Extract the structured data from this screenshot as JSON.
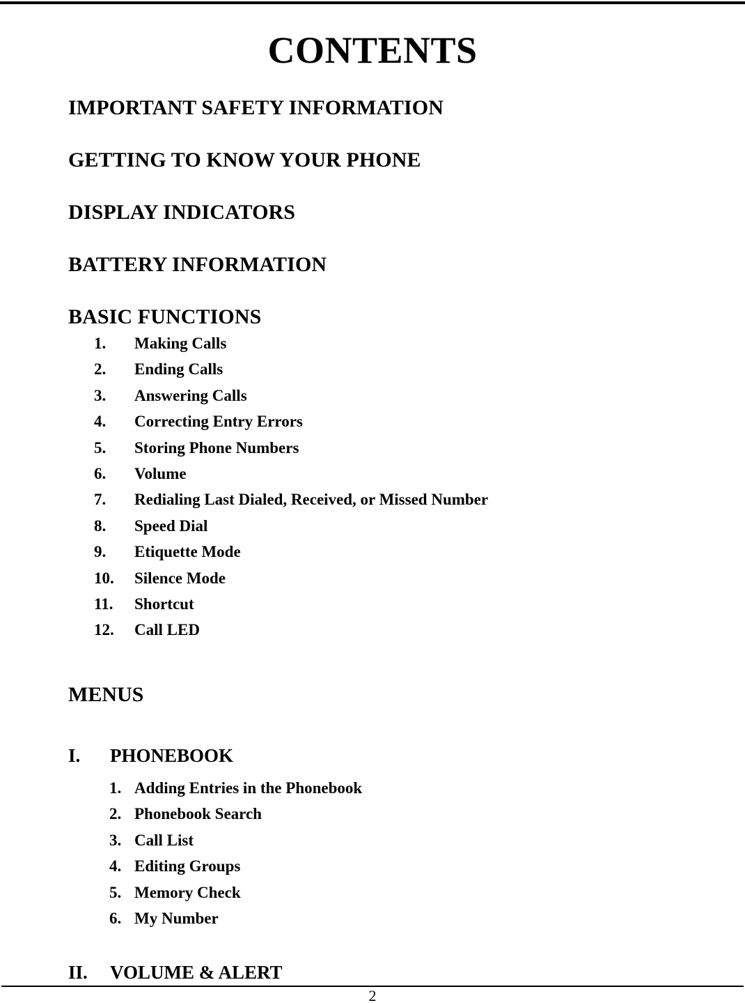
{
  "document": {
    "title": "CONTENTS",
    "page_number": "2"
  },
  "sections": [
    {
      "heading": "IMPORTANT SAFETY INFORMATION"
    },
    {
      "heading": "GETTING TO KNOW YOUR PHONE"
    },
    {
      "heading": "DISPLAY INDICATORS"
    },
    {
      "heading": "BATTERY INFORMATION"
    },
    {
      "heading": "BASIC FUNCTIONS",
      "items": [
        {
          "number": "1.",
          "label": "Making Calls"
        },
        {
          "number": "2.",
          "label": "Ending Calls"
        },
        {
          "number": "3.",
          "label": "Answering Calls"
        },
        {
          "number": "4.",
          "label": "Correcting Entry Errors"
        },
        {
          "number": "5.",
          "label": "Storing Phone Numbers"
        },
        {
          "number": "6.",
          "label": "Volume"
        },
        {
          "number": "7.",
          "label": "Redialing Last Dialed, Received, or Missed Number"
        },
        {
          "number": "8.",
          "label": "Speed Dial"
        },
        {
          "number": "9.",
          "label": "Etiquette Mode"
        },
        {
          "number": "10.",
          "label": "Silence Mode"
        },
        {
          "number": "11.",
          "label": "Shortcut"
        },
        {
          "number": "12.",
          "label": "Call LED"
        }
      ]
    }
  ],
  "menus": {
    "heading": "MENUS",
    "entries": [
      {
        "numeral": "I.",
        "label": "PHONEBOOK",
        "items": [
          {
            "number": "1.",
            "label": "Adding Entries in the Phonebook"
          },
          {
            "number": "2.",
            "label": "Phonebook Search"
          },
          {
            "number": "3.",
            "label": "Call List"
          },
          {
            "number": "4.",
            "label": "Editing Groups"
          },
          {
            "number": "5.",
            "label": "Memory Check"
          },
          {
            "number": "6.",
            "label": "My Number"
          }
        ]
      },
      {
        "numeral": "II.",
        "label": "VOLUME & ALERT",
        "items": []
      }
    ]
  }
}
